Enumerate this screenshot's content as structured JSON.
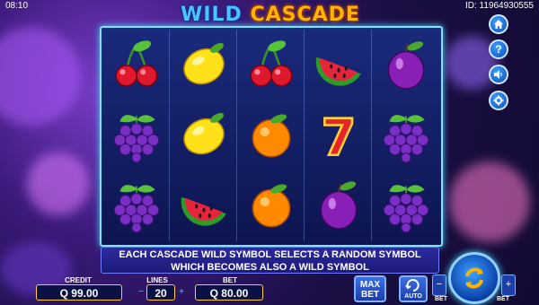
{
  "status": {
    "clock": "08:10",
    "game_id": "ID: 11964930555"
  },
  "title": {
    "part1": "WILD",
    "part2": "CASCADE"
  },
  "reels": [
    [
      "cherry-symbol",
      "grapes-symbol",
      "grapes-symbol"
    ],
    [
      "lemon-symbol",
      "lemon-symbol",
      "watermelon-symbol"
    ],
    [
      "cherry-symbol",
      "orange-symbol",
      "orange-symbol"
    ],
    [
      "watermelon-symbol",
      "seven-symbol",
      "plum-symbol"
    ],
    [
      "plum-symbol",
      "grapes-symbol",
      "grapes-symbol"
    ]
  ],
  "message": {
    "line1": "EACH CASCADE WILD SYMBOL SELECTS A RANDOM SYMBOL",
    "line2": "WHICH BECOMES ALSO A WILD SYMBOL"
  },
  "side_menu": {
    "home": "home-icon",
    "help": "?",
    "sound": "speaker-icon",
    "settings": "gear-icon"
  },
  "footer": {
    "credit_label": "CREDIT",
    "credit_value": "Q 99.00",
    "lines_label": "LINES",
    "lines_value": "20",
    "bet_label": "BET",
    "bet_value": "Q 80.00",
    "maxbet_line1": "MAX",
    "maxbet_line2": "BET",
    "auto_label": "AUTO",
    "bet_minus_label": "BET",
    "bet_plus_label": "BET",
    "minus": "−",
    "plus": "+"
  },
  "colors": {
    "accent": "#4fc3ff",
    "gold": "#ffcc33",
    "panel": "#1d1b78"
  }
}
